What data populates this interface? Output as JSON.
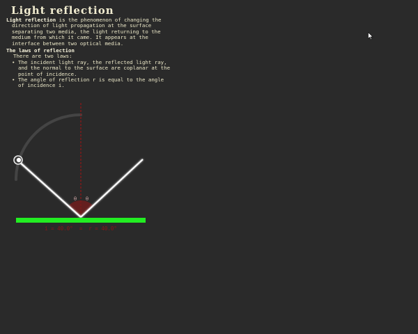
{
  "page": {
    "title": "Light reflection"
  },
  "definition": {
    "term": "Light reflection",
    "text": " is the phenomenon of changing the direction of light propagation at the surface separating two media, the light returning to the medium from which it came. It appears at the interface between two optical media."
  },
  "laws": {
    "heading": "The laws of reflection",
    "intro": "There are two laws:",
    "items": [
      "The incident light ray, the reflected light ray, and the normal to the surface are coplanar at the point of incidence.",
      "The angle of reflection r is equal to the angle of incidence i."
    ]
  },
  "diagram": {
    "angle_label_left": "θ",
    "angle_label_right": "θ",
    "readout": "i = 40.0°  =  r = 40.0°",
    "colors": {
      "mirror": "#22ee22",
      "ray": "#ffffff",
      "normal": "#8a1818",
      "arc": "#444444",
      "angle_fill": "#7a1c1c",
      "readout": "#8a1818"
    },
    "icons": {
      "source": "flashlight-icon",
      "cursor": "mouse-pointer-icon"
    }
  }
}
